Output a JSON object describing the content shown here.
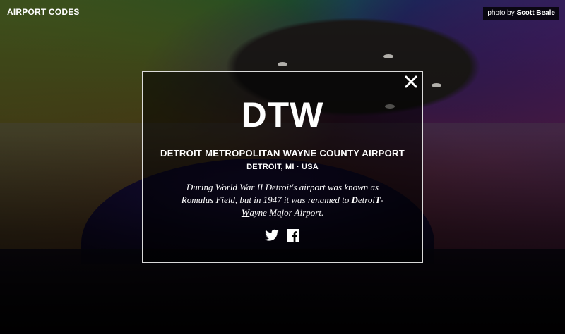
{
  "header": {
    "brand": "AIRPORT CODES",
    "credit_prefix": "photo by",
    "credit_name": "Scott Beale"
  },
  "modal": {
    "close_glyph": "✕",
    "code": "DTW",
    "name": "DETROIT METROPOLITAN WAYNE COUNTY AIRPORT",
    "location": "DETROIT, MI · USA",
    "description": {
      "part1": "During World War II Detroit's airport was known as Romulus Field, but in 1947 it was renamed to ",
      "d": "D",
      "etroi": "etroi",
      "t": "T",
      "dash": "-",
      "w": "W",
      "part2": "ayne Major Airport."
    },
    "social": {
      "twitter": "twitter-icon",
      "facebook": "facebook-icon"
    }
  },
  "colors": {
    "text": "#ffffff",
    "overlay": "rgba(0,0,0,0.55)",
    "border": "#ffffff"
  }
}
